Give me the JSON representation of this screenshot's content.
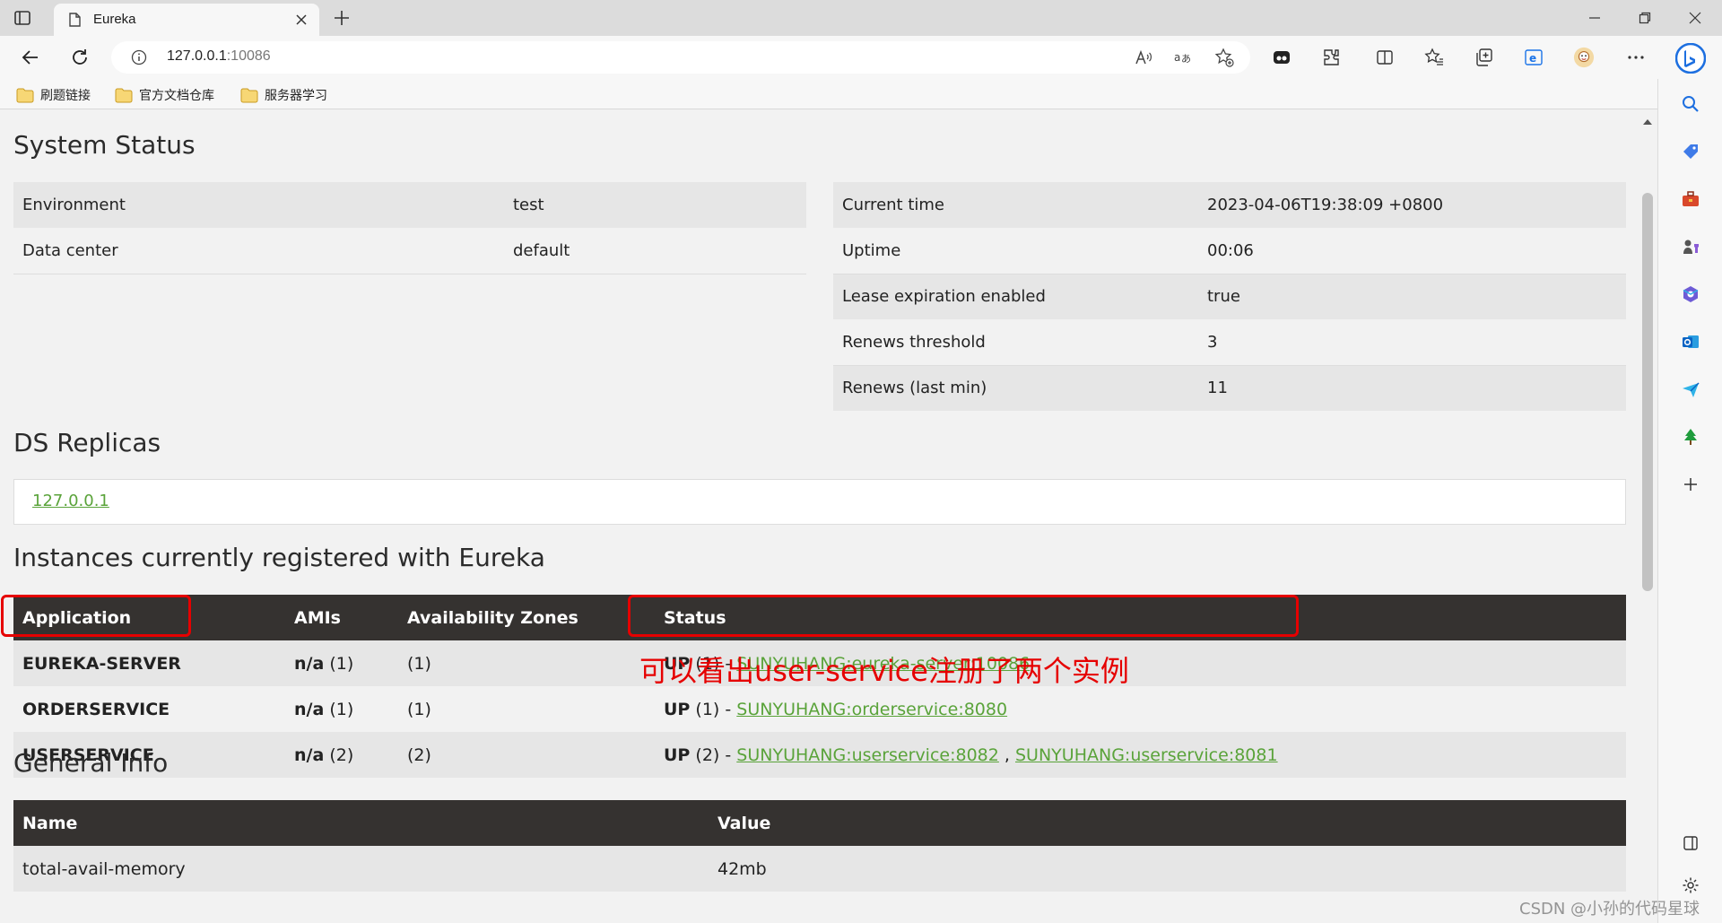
{
  "browser": {
    "tab_title": "Eureka",
    "address_host": "127.0.0.1",
    "address_port": ":10086",
    "bookmarks": [
      "刷题链接",
      "官方文档仓库",
      "服务器学习"
    ]
  },
  "page": {
    "system_status_title": "System Status",
    "left_status": [
      {
        "key": "Environment",
        "value": "test"
      },
      {
        "key": "Data center",
        "value": "default"
      }
    ],
    "right_status": [
      {
        "key": "Current time",
        "value": "2023-04-06T19:38:09 +0800"
      },
      {
        "key": "Uptime",
        "value": "00:06"
      },
      {
        "key": "Lease expiration enabled",
        "value": "true"
      },
      {
        "key": "Renews threshold",
        "value": "3"
      },
      {
        "key": "Renews (last min)",
        "value": "11"
      }
    ],
    "ds_replicas_title": "DS Replicas",
    "replica_link": "127.0.0.1",
    "instances_title": "Instances currently registered with Eureka",
    "instances_headers": [
      "Application",
      "AMIs",
      "Availability Zones",
      "Status"
    ],
    "instances": [
      {
        "app": "EUREKA-SERVER",
        "amis_label": "n/a",
        "amis_count": "(1)",
        "zones": "(1)",
        "status": "UP",
        "status_count": "(1)",
        "sep": "-",
        "links": [
          "SUNYUHANG:eureka-server:10086"
        ]
      },
      {
        "app": "ORDERSERVICE",
        "amis_label": "n/a",
        "amis_count": "(1)",
        "zones": "(1)",
        "status": "UP",
        "status_count": "(1)",
        "sep": "-",
        "links": [
          "SUNYUHANG:orderservice:8080"
        ]
      },
      {
        "app": "USERSERVICE",
        "amis_label": "n/a",
        "amis_count": "(2)",
        "zones": "(2)",
        "status": "UP",
        "status_count": "(2)",
        "sep": "-",
        "links": [
          "SUNYUHANG:userservice:8082",
          "SUNYUHANG:userservice:8081"
        ],
        "link_sep": ","
      }
    ],
    "general_info_title": "General Info",
    "general_headers": [
      "Name",
      "Value"
    ],
    "general_rows": [
      {
        "name": "total-avail-memory",
        "value": "42mb"
      }
    ]
  },
  "annotation": "可以看出user-service注册了两个实例",
  "watermark": "CSDN @小孙的代码星球",
  "colors": {
    "link": "#5aa33a",
    "table_header": "#353230",
    "highlight": "#e60000"
  }
}
